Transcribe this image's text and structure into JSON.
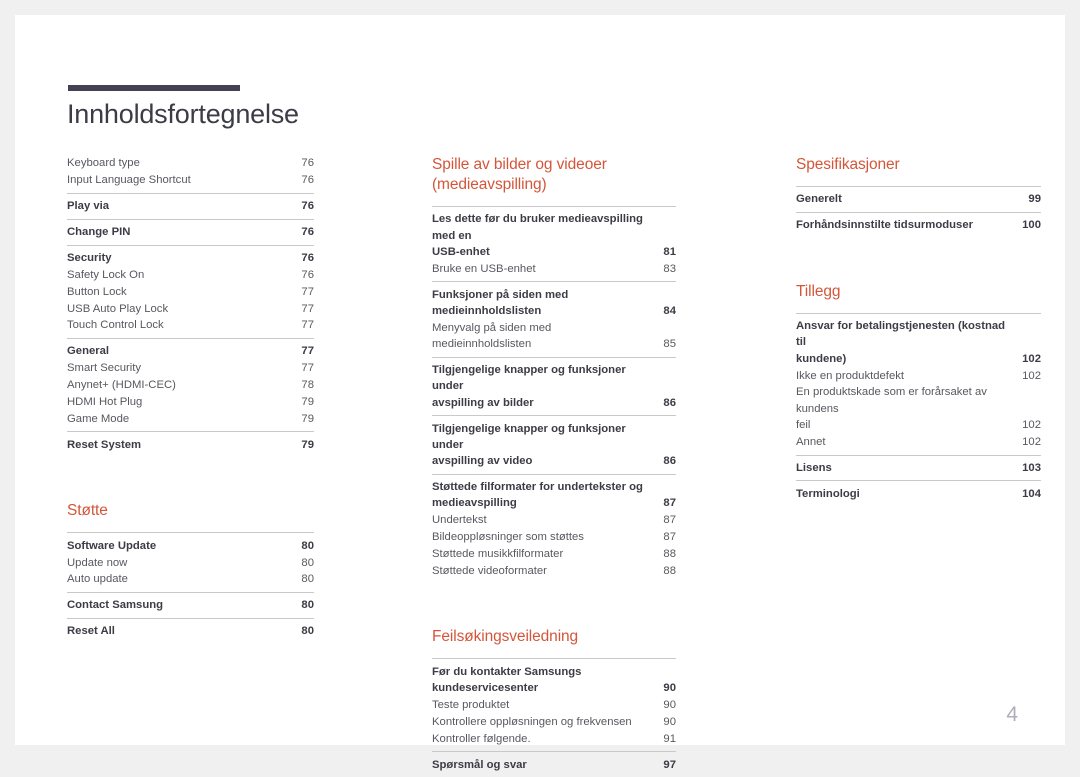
{
  "document": {
    "title": "Innholdsfortegnelse",
    "page_number": "4",
    "accent_color": "#d4563a",
    "rule_color": "#454154"
  },
  "columns": [
    {
      "name": "column-left",
      "sections": [
        {
          "heading": null,
          "groups": [
            {
              "rule": false,
              "entries": [
                {
                  "label": "Keyboard type",
                  "page": "76",
                  "bold": false
                },
                {
                  "label": "Input Language Shortcut",
                  "page": "76",
                  "bold": false
                }
              ]
            },
            {
              "rule": true,
              "entries": [
                {
                  "label": "Play via",
                  "page": "76",
                  "bold": true
                }
              ]
            },
            {
              "rule": true,
              "entries": [
                {
                  "label": "Change PIN",
                  "page": "76",
                  "bold": true
                }
              ]
            },
            {
              "rule": true,
              "entries": [
                {
                  "label": "Security",
                  "page": "76",
                  "bold": true
                },
                {
                  "label": "Safety Lock On",
                  "page": "76",
                  "bold": false
                },
                {
                  "label": "Button Lock",
                  "page": "77",
                  "bold": false
                },
                {
                  "label": "USB Auto Play Lock",
                  "page": "77",
                  "bold": false
                },
                {
                  "label": "Touch Control Lock",
                  "page": "77",
                  "bold": false
                }
              ]
            },
            {
              "rule": true,
              "entries": [
                {
                  "label": "General",
                  "page": "77",
                  "bold": true
                },
                {
                  "label": "Smart Security",
                  "page": "77",
                  "bold": false
                },
                {
                  "label": "Anynet+ (HDMI-CEC)",
                  "page": "78",
                  "bold": false
                },
                {
                  "label": "HDMI Hot Plug",
                  "page": "79",
                  "bold": false
                },
                {
                  "label": "Game Mode",
                  "page": "79",
                  "bold": false
                }
              ]
            },
            {
              "rule": true,
              "entries": [
                {
                  "label": "Reset System",
                  "page": "79",
                  "bold": true
                }
              ]
            }
          ]
        },
        {
          "heading": "Støtte",
          "groups": [
            {
              "rule": true,
              "entries": [
                {
                  "label": "Software Update",
                  "page": "80",
                  "bold": true
                },
                {
                  "label": "Update now",
                  "page": "80",
                  "bold": false
                },
                {
                  "label": "Auto update",
                  "page": "80",
                  "bold": false
                }
              ]
            },
            {
              "rule": true,
              "entries": [
                {
                  "label": "Contact Samsung",
                  "page": "80",
                  "bold": true
                }
              ]
            },
            {
              "rule": true,
              "entries": [
                {
                  "label": "Reset All",
                  "page": "80",
                  "bold": true
                }
              ]
            }
          ]
        }
      ]
    },
    {
      "name": "column-middle",
      "sections": [
        {
          "heading": "Spille av bilder og videoer\n(medieavspilling)",
          "groups": [
            {
              "rule": true,
              "entries": [
                {
                  "label": "Les dette før du bruker medieavspilling med en\nUSB-enhet",
                  "page": "81",
                  "bold": true
                },
                {
                  "label": "Bruke en USB-enhet",
                  "page": "83",
                  "bold": false
                }
              ]
            },
            {
              "rule": true,
              "entries": [
                {
                  "label": "Funksjoner på siden med medieinnholdslisten",
                  "page": "84",
                  "bold": true
                },
                {
                  "label": "Menyvalg på siden med medieinnholdslisten",
                  "page": "85",
                  "bold": false
                }
              ]
            },
            {
              "rule": true,
              "entries": [
                {
                  "label": "Tilgjengelige knapper og funksjoner under\navspilling av bilder",
                  "page": "86",
                  "bold": true
                }
              ]
            },
            {
              "rule": true,
              "entries": [
                {
                  "label": "Tilgjengelige knapper og funksjoner under\navspilling av video",
                  "page": "86",
                  "bold": true
                }
              ]
            },
            {
              "rule": true,
              "entries": [
                {
                  "label": "Støttede filformater for undertekster og\nmedieavspilling",
                  "page": "87",
                  "bold": true
                },
                {
                  "label": "Undertekst",
                  "page": "87",
                  "bold": false
                },
                {
                  "label": "Bildeoppløsninger som støttes",
                  "page": "87",
                  "bold": false
                },
                {
                  "label": "Støttede musikkfilformater",
                  "page": "88",
                  "bold": false
                },
                {
                  "label": "Støttede videoformater",
                  "page": "88",
                  "bold": false
                }
              ]
            }
          ]
        },
        {
          "heading": "Feilsøkingsveiledning",
          "groups": [
            {
              "rule": true,
              "entries": [
                {
                  "label": "Før du kontakter Samsungs\nkundeservicesenter",
                  "page": "90",
                  "bold": true
                },
                {
                  "label": "Teste produktet",
                  "page": "90",
                  "bold": false
                },
                {
                  "label": "Kontrollere oppløsningen og frekvensen",
                  "page": "90",
                  "bold": false
                },
                {
                  "label": "Kontroller følgende.",
                  "page": "91",
                  "bold": false
                }
              ]
            },
            {
              "rule": true,
              "entries": [
                {
                  "label": "Spørsmål og svar",
                  "page": "97",
                  "bold": true
                }
              ]
            }
          ]
        }
      ]
    },
    {
      "name": "column-right",
      "sections": [
        {
          "heading": "Spesifikasjoner",
          "groups": [
            {
              "rule": true,
              "entries": [
                {
                  "label": "Generelt",
                  "page": "99",
                  "bold": true
                }
              ]
            },
            {
              "rule": true,
              "entries": [
                {
                  "label": "Forhåndsinnstilte tidsurmoduser",
                  "page": "100",
                  "bold": true
                }
              ]
            }
          ]
        },
        {
          "heading": "Tillegg",
          "groups": [
            {
              "rule": true,
              "entries": [
                {
                  "label": "Ansvar for betalingstjenesten (kostnad til\nkundene)",
                  "page": "102",
                  "bold": true
                },
                {
                  "label": "Ikke en produktdefekt",
                  "page": "102",
                  "bold": false
                },
                {
                  "label": "En produktskade som er forårsaket av kundens\nfeil",
                  "page": "102",
                  "bold": false
                },
                {
                  "label": "Annet",
                  "page": "102",
                  "bold": false
                }
              ]
            },
            {
              "rule": true,
              "entries": [
                {
                  "label": "Lisens",
                  "page": "103",
                  "bold": true
                }
              ]
            },
            {
              "rule": true,
              "entries": [
                {
                  "label": "Terminologi",
                  "page": "104",
                  "bold": true
                }
              ]
            }
          ]
        }
      ]
    }
  ]
}
